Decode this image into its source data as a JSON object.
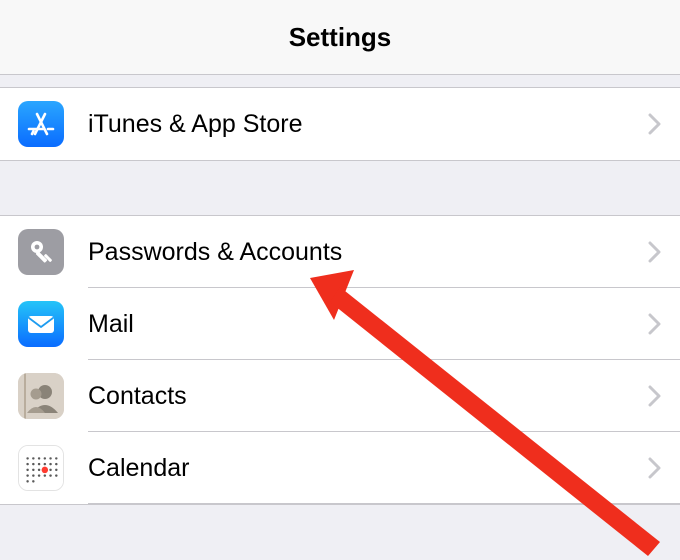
{
  "header": {
    "title": "Settings"
  },
  "sections": {
    "group1": [
      {
        "id": "itunes-app-store",
        "icon": "app-store-icon",
        "label": "iTunes & App Store"
      }
    ],
    "group2": [
      {
        "id": "passwords-accounts",
        "icon": "key-icon",
        "label": "Passwords & Accounts"
      },
      {
        "id": "mail",
        "icon": "mail-icon",
        "label": "Mail"
      },
      {
        "id": "contacts",
        "icon": "contacts-icon",
        "label": "Contacts"
      },
      {
        "id": "calendar",
        "icon": "calendar-icon",
        "label": "Calendar"
      }
    ]
  },
  "annotation": {
    "type": "arrow",
    "target": "passwords-accounts",
    "color": "#ef2e1d"
  }
}
